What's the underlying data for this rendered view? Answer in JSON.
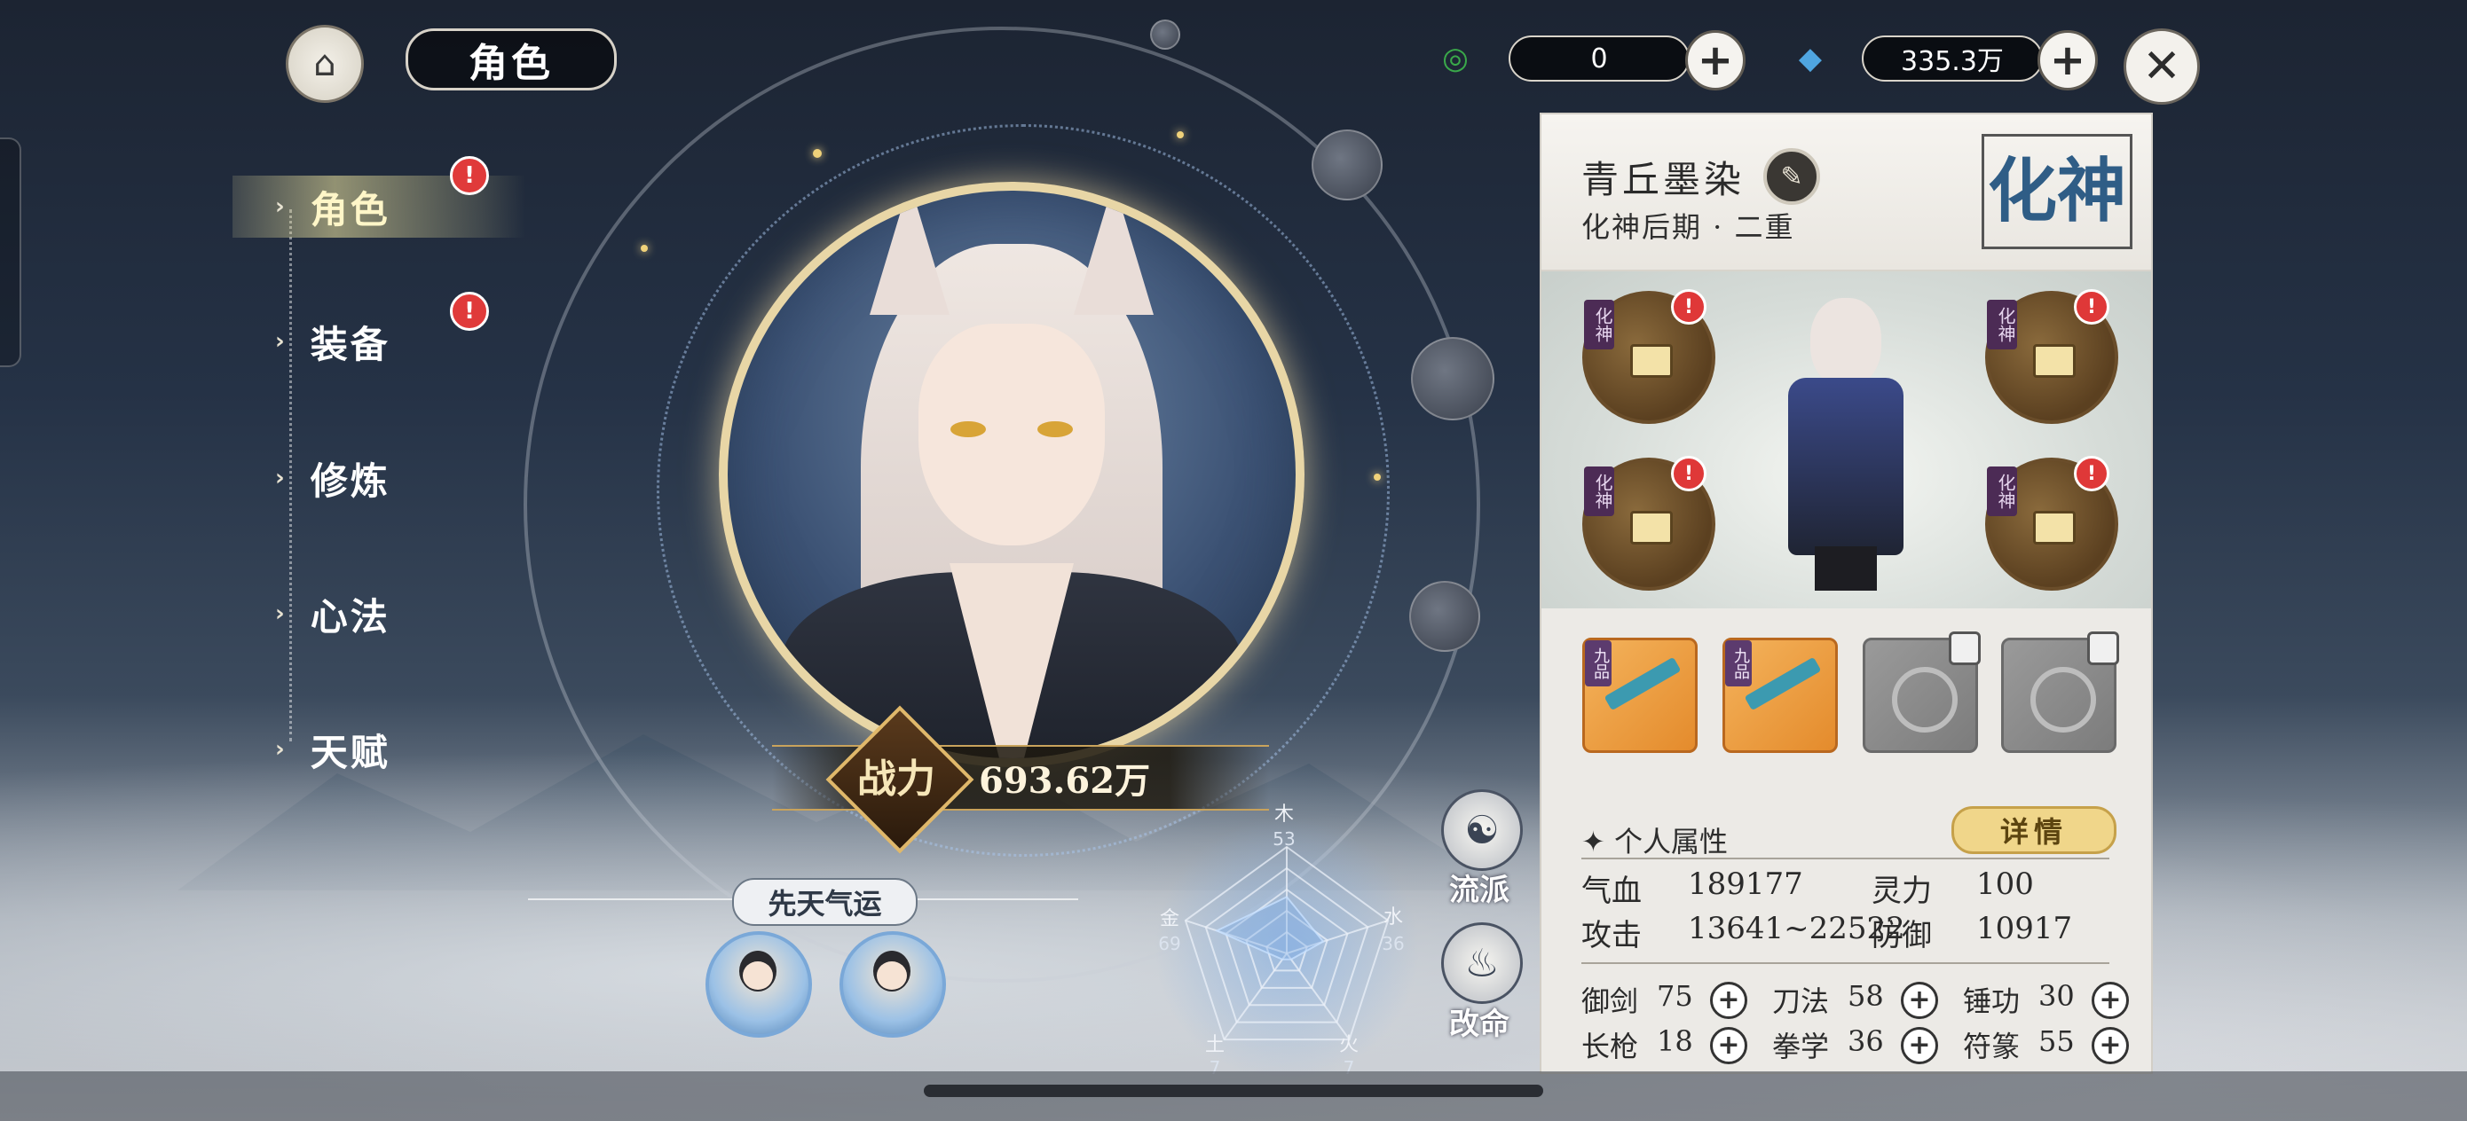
{
  "header": {
    "title": "角色",
    "home_icon": "palace-icon",
    "currency1": {
      "icon": "jade-ring-icon",
      "value": "0",
      "color": "#3aa84a"
    },
    "currency2": {
      "icon": "spirit-crystal-icon",
      "value": "335.3万",
      "color": "#4fa5e0"
    },
    "close_icon": "close-icon"
  },
  "menu": {
    "items": [
      {
        "label": "角色",
        "active": true,
        "badge": "!"
      },
      {
        "label": "装备",
        "active": false,
        "badge": "!"
      },
      {
        "label": "修炼",
        "active": false,
        "badge": ""
      },
      {
        "label": "心法",
        "active": false,
        "badge": ""
      },
      {
        "label": "天赋",
        "active": false,
        "badge": ""
      }
    ]
  },
  "power": {
    "label": "战力",
    "value": "693.62万"
  },
  "fortune": {
    "label": "先天气运"
  },
  "radar": {
    "labels": [
      "木",
      "水",
      "火",
      "土",
      "金"
    ],
    "values": [
      "53",
      "36",
      "7",
      "7",
      "69"
    ],
    "max": 100
  },
  "side_buttons": {
    "sect": "流派",
    "fate": "改命"
  },
  "panel": {
    "name": "青丘墨染",
    "realm": "化神后期 · 二重",
    "realm_stamp": "化神",
    "equip_tag": "化神",
    "skill_grade": "九品",
    "attr_title": "个人属性",
    "detail_button": "详情",
    "stats": {
      "hp_label": "气血",
      "hp": "189177",
      "spirit_label": "灵力",
      "spirit": "100",
      "atk_label": "攻击",
      "atk": "13641~22522",
      "def_label": "防御",
      "def": "10917"
    },
    "skills": [
      {
        "label": "御剑",
        "value": "75"
      },
      {
        "label": "刀法",
        "value": "58"
      },
      {
        "label": "锤功",
        "value": "30"
      },
      {
        "label": "长枪",
        "value": "18"
      },
      {
        "label": "拳学",
        "value": "36"
      },
      {
        "label": "符篆",
        "value": "55"
      }
    ]
  }
}
